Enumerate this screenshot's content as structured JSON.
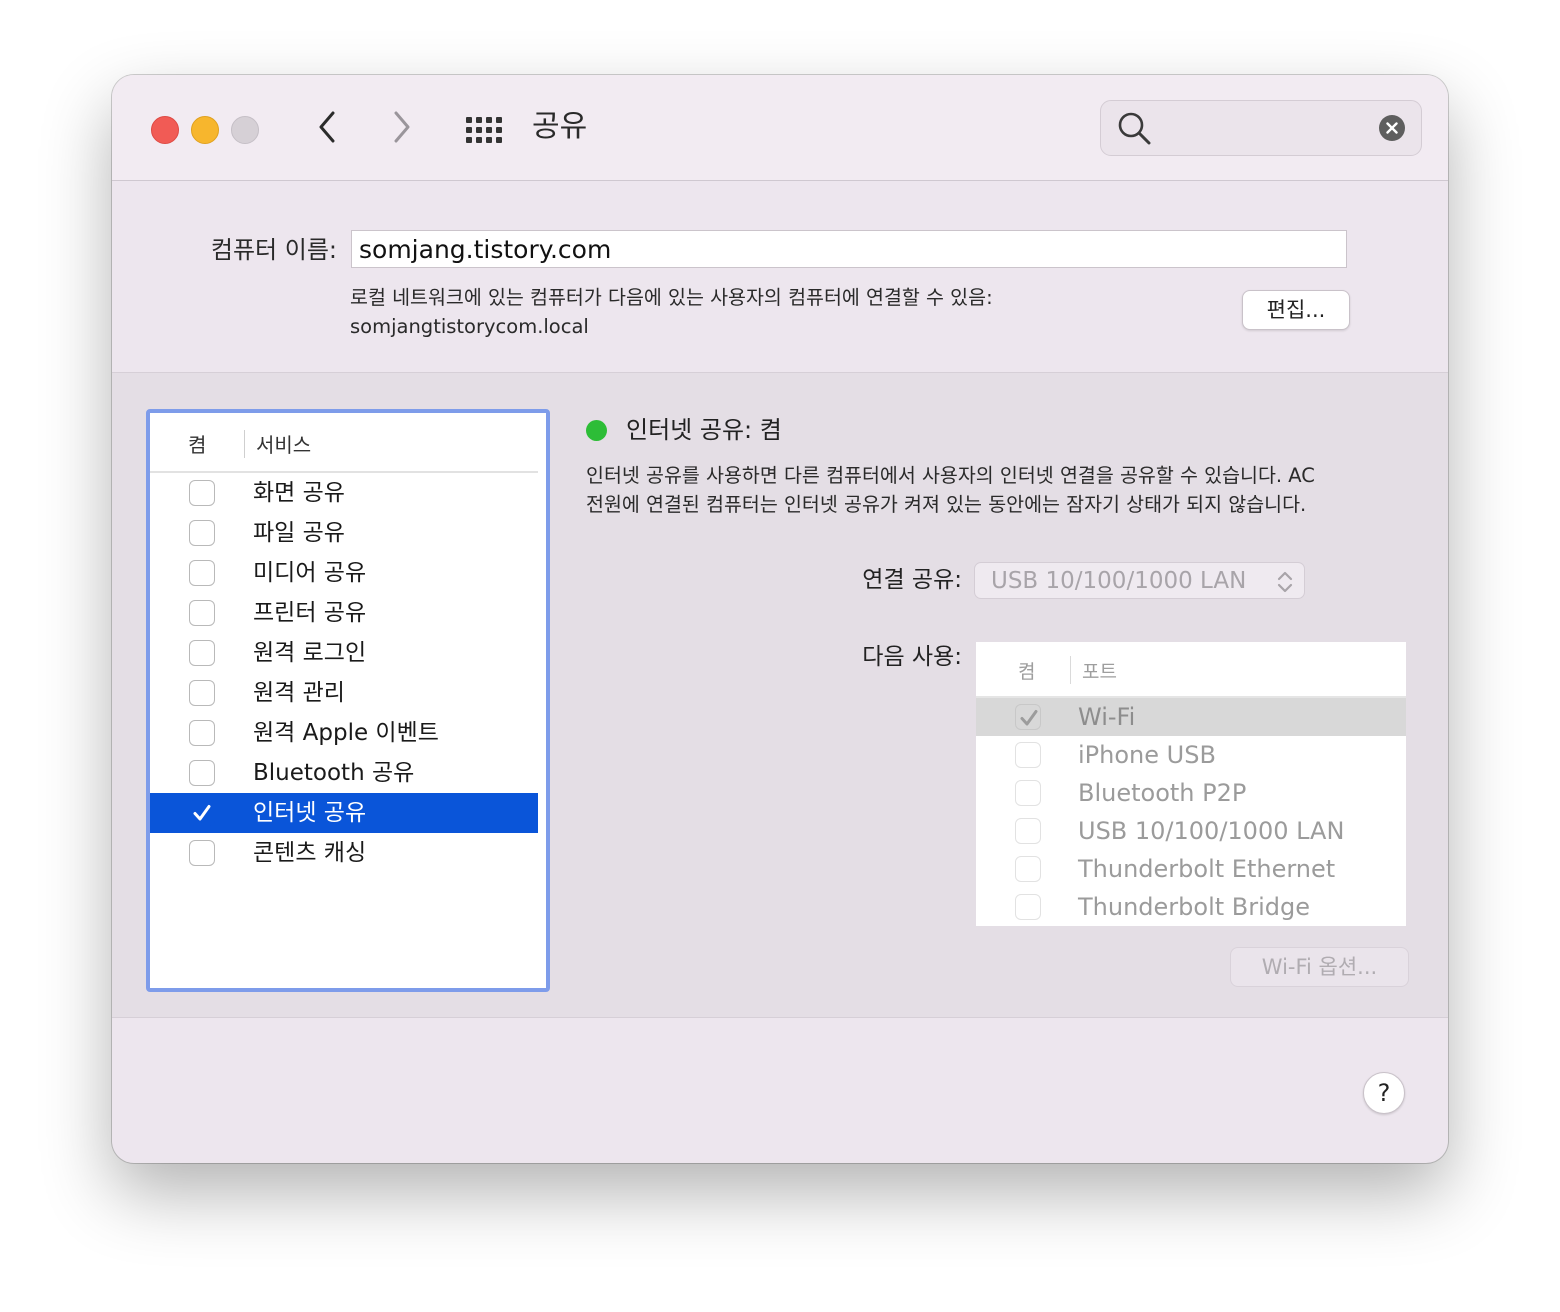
{
  "window": {
    "title": "공유",
    "search": {
      "value": ""
    }
  },
  "computer_name": {
    "label": "컴퓨터 이름:",
    "value": "somjang.tistory.com",
    "local_line1": "로컬 네트워크에 있는 컴퓨터가 다음에 있는 사용자의 컴퓨터에 연결할 수 있음:",
    "local_line2": "somjangtistorycom.local",
    "edit_button": "편집..."
  },
  "services": {
    "header_on": "켬",
    "header_service": "서비스",
    "items": [
      {
        "label": "화면 공유",
        "checked": false
      },
      {
        "label": "파일 공유",
        "checked": false
      },
      {
        "label": "미디어 공유",
        "checked": false
      },
      {
        "label": "프린터 공유",
        "checked": false
      },
      {
        "label": "원격 로그인",
        "checked": false
      },
      {
        "label": "원격 관리",
        "checked": false
      },
      {
        "label": "원격 Apple 이벤트",
        "checked": false
      },
      {
        "label": "Bluetooth 공유",
        "checked": false
      },
      {
        "label": "인터넷 공유",
        "checked": true,
        "selected": true
      },
      {
        "label": "콘텐츠 캐싱",
        "checked": false
      }
    ]
  },
  "detail": {
    "status_text": "인터넷 공유: 켬",
    "status_color": "#2dbd37",
    "description_line1": "인터넷 공유를 사용하면 다른 컴퓨터에서 사용자의 인터넷 연결을 공유할 수 있습니다. AC",
    "description_line2": "전원에 연결된 컴퓨터는 인터넷 공유가 켜져 있는 동안에는 잠자기 상태가 되지 않습니다.",
    "connection_label": "연결 공유:",
    "connection_value": "USB 10/100/1000 LAN",
    "use_label": "다음 사용:",
    "ports_header_on": "켬",
    "ports_header_port": "포트",
    "ports": [
      {
        "label": "Wi-Fi",
        "checked": true,
        "selected": true
      },
      {
        "label": "iPhone USB",
        "checked": false
      },
      {
        "label": "Bluetooth P2P",
        "checked": false
      },
      {
        "label": "USB 10/100/1000 LAN",
        "checked": false
      },
      {
        "label": "Thunderbolt Ethernet",
        "checked": false
      },
      {
        "label": "Thunderbolt Bridge",
        "checked": false
      }
    ],
    "wifi_options_button": "Wi-Fi 옵션..."
  },
  "help_button": "?",
  "colors": {
    "selection": "#0a55d9",
    "list_focus_ring": "#7e9cea",
    "close": "#f15b55",
    "minimize": "#f7b62d",
    "zoom": "#d6d0d6"
  }
}
